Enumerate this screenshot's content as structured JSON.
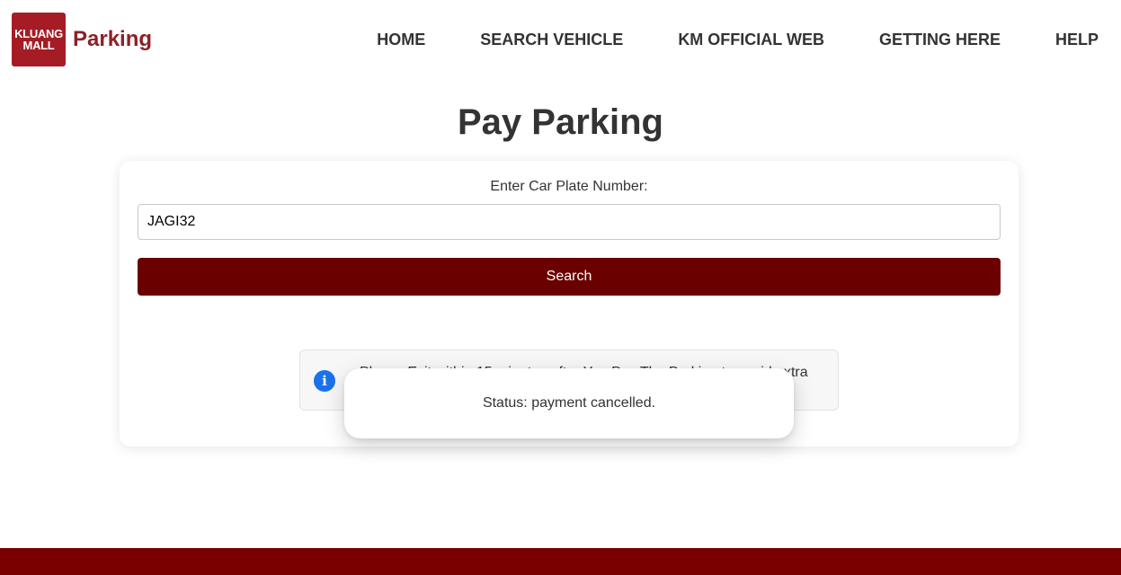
{
  "header": {
    "logo": {
      "line1": "KLUANG",
      "line2": "MALL"
    },
    "brand": "Parking",
    "nav": [
      {
        "label": "HOME"
      },
      {
        "label": "SEARCH VEHICLE"
      },
      {
        "label": "KM OFFICIAL WEB"
      },
      {
        "label": "GETTING HERE"
      },
      {
        "label": "HELP"
      }
    ]
  },
  "main": {
    "title": "Pay Parking",
    "plate_label": "Enter Car Plate Number:",
    "plate_value": "JAGI32",
    "search_label": "Search",
    "notice": {
      "icon": "info-icon",
      "text": "Please Exit within 15 minutes after You Pay The Parking to avoid extra"
    }
  },
  "toast": {
    "message": "Status: payment cancelled."
  },
  "colors": {
    "brand": "#8c2127",
    "button": "#6b0000",
    "footer": "#7a0000",
    "info": "#1a73e8"
  }
}
